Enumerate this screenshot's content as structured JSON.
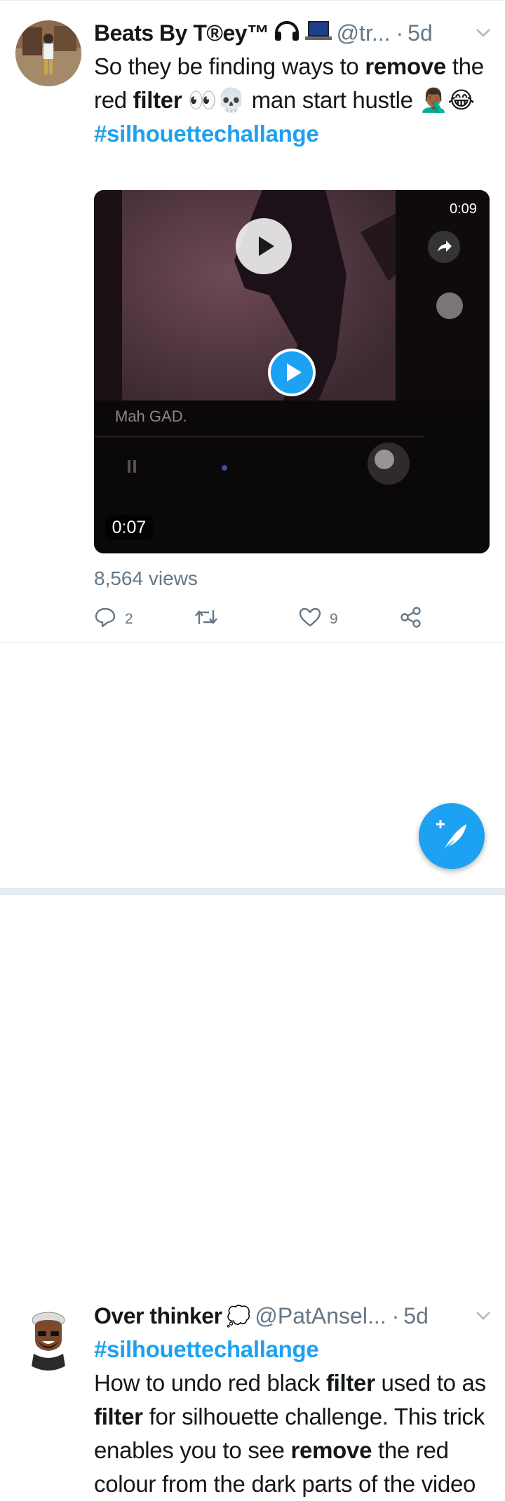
{
  "tweets": [
    {
      "name": "Beats By T®ey™",
      "handle": "@tr...",
      "sep": "·",
      "time": "5d",
      "text": [
        {
          "t": "So they be finding ways to ",
          "b": false
        },
        {
          "t": "remove",
          "b": true
        },
        {
          "t": " the red ",
          "b": false
        },
        {
          "t": "filter",
          "b": true
        },
        {
          "t": " 👀💀 man start hustle 🤦🏾‍♂️😂",
          "b": false
        }
      ],
      "hashtag": "#silhouettechallange",
      "video": {
        "overlay_time": "0:09",
        "caption": "Mah GAD.",
        "duration": "0:07"
      },
      "views": "8,564 views",
      "reply_count": "2",
      "retweet_count": "",
      "like_count": "9"
    },
    {
      "name": "Over thinker",
      "name_emoji": "💭",
      "handle": "@PatAnsel...",
      "sep": "·",
      "time": "5d",
      "hashtag": "#silhouettechallange",
      "text": [
        {
          "t": "How to undo red black ",
          "b": false
        },
        {
          "t": "filter",
          "b": true
        },
        {
          "t": " used to as ",
          "b": false
        },
        {
          "t": "filter",
          "b": true
        },
        {
          "t": " for silhouette challenge. This trick enables you to see ",
          "b": false
        },
        {
          "t": "remove",
          "b": true
        },
        {
          "t": " the red colour from the dark parts of the video",
          "b": false
        }
      ]
    }
  ],
  "colors": {
    "accent": "#1da1f2",
    "muted": "#657786",
    "text": "#14171a"
  },
  "icons": [
    "chevron-down-icon",
    "play-icon",
    "share-icon",
    "reply-icon",
    "retweet-icon",
    "like-icon",
    "share-tweet-icon",
    "compose-tweet-icon"
  ]
}
